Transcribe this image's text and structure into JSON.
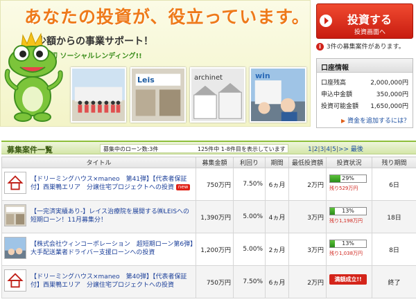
{
  "banner": {
    "headline": "あなたの投資が、役立っています。",
    "subheading": "少額からの事業サポート！",
    "tagline": "日本初 ソーシャルレンディング!!",
    "photo_labels": [
      "Leis",
      "archinet",
      "win"
    ]
  },
  "invest_button": {
    "main": "投資する",
    "sub": "投資画面へ"
  },
  "notice": {
    "text": "3件の募集案件があります。"
  },
  "account": {
    "title": "口座情報",
    "rows": [
      {
        "label": "口座残高",
        "value": "2,000,000円"
      },
      {
        "label": "申込中金額",
        "value": "350,000円"
      },
      {
        "label": "投資可能金額",
        "value": "1,650,000円"
      }
    ],
    "add_funds": "資金を追加するには？"
  },
  "listing": {
    "title": "募集案件一覧",
    "count": "募集中のローン数:3件",
    "range": "125件中 1-8件目を表示しています",
    "pages": [
      "1",
      "2",
      "3",
      "4",
      "5",
      ">>",
      "最後"
    ]
  },
  "table": {
    "headers": [
      "タイトル",
      "募集金額",
      "利回り",
      "期間",
      "最低投資額",
      "投資状況",
      "残り期間"
    ],
    "rows": [
      {
        "title": "【ドリーミングハウス×maneo　第41弾】【代表者保証付】西巣鴨エリア　分譲住宅プロジェクトへの投資",
        "new_label": "new",
        "amount": "750万円",
        "yield": "7.50%",
        "term": "6ヵ月",
        "min": "2万円",
        "status_percent": "29%",
        "progress": 0.29,
        "remaining_amount": "残り529万円",
        "closed_label": "",
        "remaining_period": "6日"
      },
      {
        "title": "【一完済実績あり-】レイス治療院を展開する㈱LEISへの短期ローン！11月募集分！",
        "new_label": "",
        "amount": "1,390万円",
        "yield": "5.00%",
        "term": "4ヵ月",
        "min": "3万円",
        "status_percent": "13%",
        "progress": 0.13,
        "remaining_amount": "残り1,198万円",
        "closed_label": "",
        "remaining_period": "18日"
      },
      {
        "title": "【株式会社ウィンコーポレーション　超短期ローン第6弾】大手配送業者ドライバー支援ローンへの投資",
        "new_label": "",
        "amount": "1,200万円",
        "yield": "5.00%",
        "term": "2ヵ月",
        "min": "3万円",
        "status_percent": "13%",
        "progress": 0.13,
        "remaining_amount": "残り1,038万円",
        "closed_label": "",
        "remaining_period": "8日"
      },
      {
        "title": "【ドリーミングハウス×maneo　第40弾】【代表者保証付】西巣鴨エリア　分譲住宅プロジェクトへの投資",
        "new_label": "",
        "amount": "750万円",
        "yield": "7.50%",
        "term": "6ヵ月",
        "min": "2万円",
        "status_percent": "",
        "progress": 1,
        "remaining_amount": "",
        "closed_label": "満額成立!!",
        "remaining_period": "終了"
      }
    ]
  },
  "colors": {
    "accent_orange": "#ee7a1a",
    "brand_green": "#8dbf3a",
    "button_red": "#d22414",
    "link_blue": "#1b4ea0"
  },
  "icons": [
    "frog-mascot-icon",
    "info-icon",
    "arrow-right-icon",
    "house-logo-icon"
  ]
}
